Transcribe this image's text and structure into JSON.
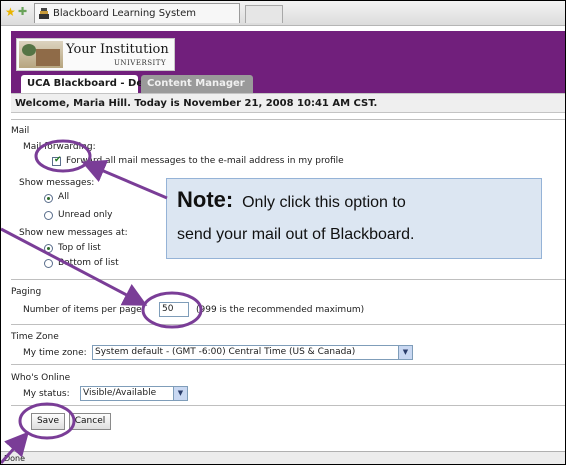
{
  "browser": {
    "tab_title": "Blackboard Learning System",
    "status": "Done"
  },
  "header": {
    "institution": "Your Institution",
    "institution_sub": "UNIVERSITY",
    "tabs": [
      {
        "label": "UCA Blackboard - Dev",
        "active": true
      },
      {
        "label": "Content Manager",
        "active": false
      }
    ],
    "welcome": "Welcome, Maria Hill. Today is November 21, 2008 10:41 AM CST."
  },
  "mail": {
    "section": "Mail",
    "forwarding_label": "Mail forwarding:",
    "forward_checkbox": "Forward all mail messages to the e-mail address in my profile",
    "forward_checked": true,
    "show_messages_label": "Show messages:",
    "show_options": [
      "All",
      "Unread only"
    ],
    "show_selected": "All",
    "new_messages_label": "Show new messages at:",
    "new_options": [
      "Top of list",
      "Bottom of list"
    ],
    "new_selected": "Top of list"
  },
  "paging": {
    "section": "Paging",
    "label": "Number of items per page",
    "value": "50",
    "hint": "(999 is the recommended maximum)"
  },
  "timezone": {
    "section": "Time Zone",
    "label": "My time zone:",
    "value": "System default - (GMT -6:00) Central Time (US & Canada)"
  },
  "online": {
    "section": "Who's Online",
    "label": "My status:",
    "value": "Visible/Available"
  },
  "buttons": {
    "save": "Save",
    "cancel": "Cancel"
  },
  "callout": {
    "label": "Note:",
    "text1": "Only click this option to",
    "text2": "send your mail out of Blackboard."
  },
  "colors": {
    "header": "#711f7c",
    "annotation": "#7a3d97",
    "note_bg": "#dce6f2"
  },
  "icons": [
    "star-icon",
    "add-favorite-icon",
    "blackboard-favicon",
    "dropdown-arrow-icon"
  ]
}
